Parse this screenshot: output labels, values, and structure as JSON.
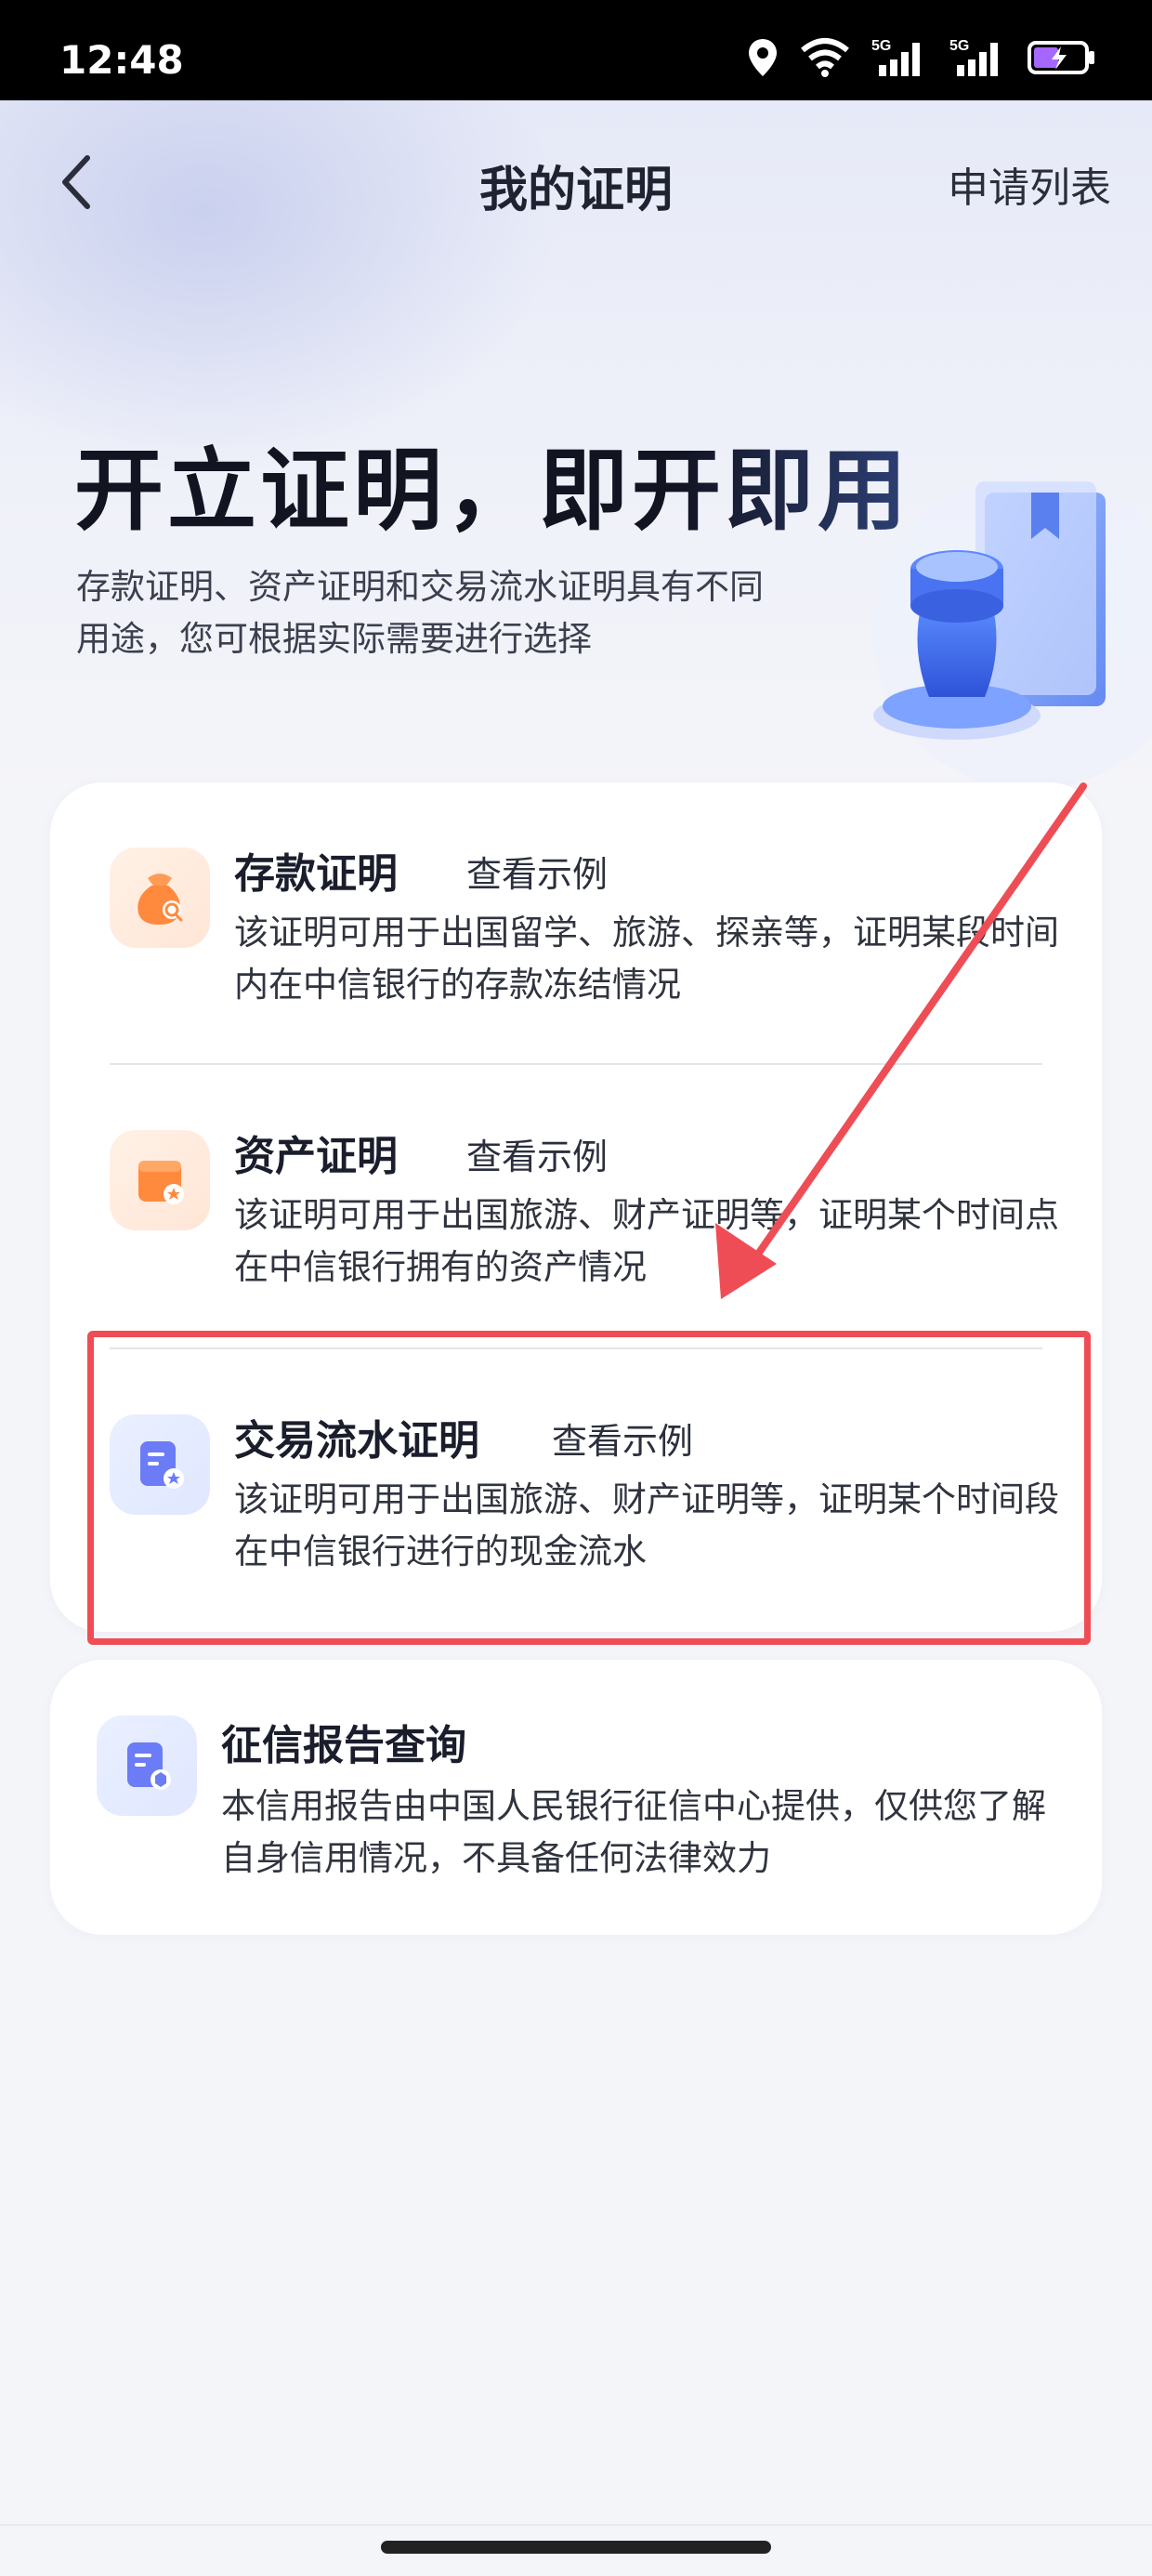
{
  "status": {
    "time": "12:48",
    "icons": [
      "location-icon",
      "wifi-icon",
      "signal-5g-icon",
      "signal-5g-icon",
      "battery-icon"
    ],
    "network_label": "5G"
  },
  "nav": {
    "title": "我的证明",
    "right_label": "申请列表"
  },
  "hero": {
    "headline": "开立证明，即开即用",
    "subline": "存款证明、资产证明和交易流水证明具有不同用途，您可根据实际需要进行选择"
  },
  "items": [
    {
      "title": "存款证明",
      "link": "查看示例",
      "desc": "该证明可用于出国留学、旅游、探亲等，证明某段时间内在中信银行的存款冻结情况",
      "icon": "money-bag-search-icon"
    },
    {
      "title": "资产证明",
      "link": "查看示例",
      "desc": "该证明可用于出国旅游、财产证明等，证明某个时间点在中信银行拥有的资产情况",
      "icon": "asset-box-icon"
    },
    {
      "title": "交易流水证明",
      "link": "查看示例",
      "desc": "该证明可用于出国旅游、财产证明等，证明某个时间段在中信银行进行的现金流水",
      "icon": "document-star-icon"
    }
  ],
  "credit": {
    "title": "征信报告查询",
    "desc": "本信用报告由中国人民银行征信中心提供，仅供您了解自身信用情况，不具备任何法律效力",
    "icon": "credit-report-icon"
  },
  "colors": {
    "accent_red": "#ef4d55",
    "orange_icon": "#ff8a3d",
    "blue_icon": "#6b7cf6"
  }
}
